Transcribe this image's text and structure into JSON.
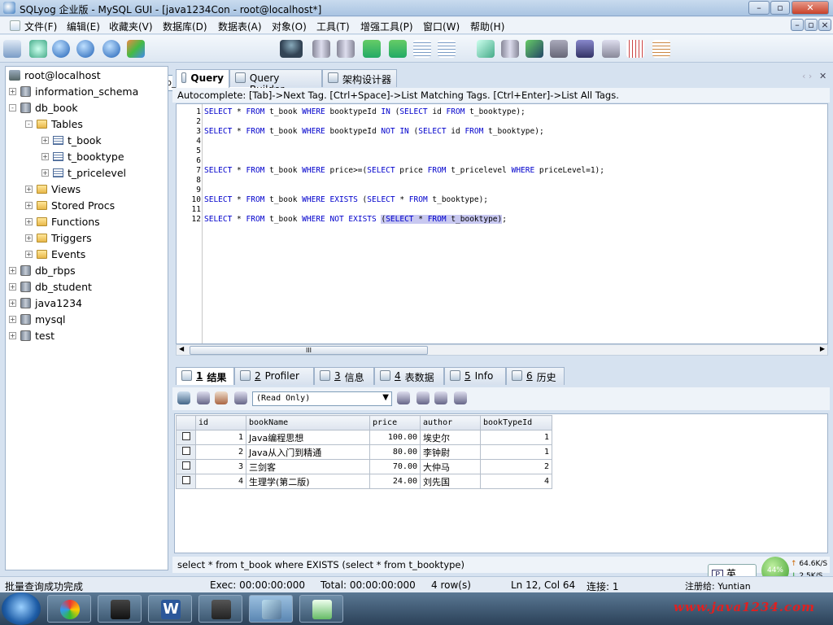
{
  "window": {
    "title": "SQLyog 企业版 - MySQL GUI - [java1234Con - root@localhost*]"
  },
  "menu": [
    "文件(F)",
    "编辑(E)",
    "收藏夹(V)",
    "数据库(D)",
    "数据表(A)",
    "对象(O)",
    "工具(T)",
    "增强工具(P)",
    "窗口(W)",
    "帮助(H)"
  ],
  "toolbar": {
    "database": "db_book"
  },
  "tree": {
    "root": "root@localhost",
    "items": [
      {
        "label": "information_schema",
        "type": "db",
        "level": 1,
        "expand": "+"
      },
      {
        "label": "db_book",
        "type": "db",
        "level": 1,
        "expand": "-"
      },
      {
        "label": "Tables",
        "type": "folder",
        "level": 2,
        "expand": "-"
      },
      {
        "label": "t_book",
        "type": "table",
        "level": 3,
        "expand": "+",
        "selected": true
      },
      {
        "label": "t_booktype",
        "type": "table",
        "level": 3,
        "expand": "+"
      },
      {
        "label": "t_pricelevel",
        "type": "table",
        "level": 3,
        "expand": "+"
      },
      {
        "label": "Views",
        "type": "folder",
        "level": 2,
        "expand": "+"
      },
      {
        "label": "Stored Procs",
        "type": "folder",
        "level": 2,
        "expand": "+"
      },
      {
        "label": "Functions",
        "type": "folder",
        "level": 2,
        "expand": "+"
      },
      {
        "label": "Triggers",
        "type": "folder",
        "level": 2,
        "expand": "+"
      },
      {
        "label": "Events",
        "type": "folder",
        "level": 2,
        "expand": "+"
      },
      {
        "label": "db_rbps",
        "type": "db",
        "level": 1,
        "expand": "+"
      },
      {
        "label": "db_student",
        "type": "db",
        "level": 1,
        "expand": "+"
      },
      {
        "label": "java1234",
        "type": "db",
        "level": 1,
        "expand": "+"
      },
      {
        "label": "mysql",
        "type": "db",
        "level": 1,
        "expand": "+"
      },
      {
        "label": "test",
        "type": "db",
        "level": 1,
        "expand": "+"
      }
    ]
  },
  "query_tabs": [
    "Query",
    "Query Builder",
    "架构设计器"
  ],
  "autocomplete_hint": "Autocomplete: [Tab]->Next Tag. [Ctrl+Space]->List Matching Tags. [Ctrl+Enter]->List All Tags.",
  "editor": {
    "lines": [
      "SELECT * FROM t_book WHERE booktypeId IN (SELECT id FROM t_booktype);",
      "",
      "SELECT * FROM t_book WHERE booktypeId NOT IN (SELECT id FROM t_booktype);",
      "",
      "",
      "",
      "SELECT * FROM t_book WHERE price>=(SELECT price FROM t_pricelevel WHERE priceLevel=1);",
      "",
      "",
      "SELECT * FROM t_book WHERE EXISTS (SELECT * FROM t_booktype);",
      "",
      "SELECT * FROM t_book WHERE NOT EXISTS (SELECT * FROM t_booktype);"
    ],
    "scroll_label": "III"
  },
  "result_tabs": [
    {
      "num": "1",
      "label": "结果"
    },
    {
      "num": "2",
      "label": "Profiler"
    },
    {
      "num": "3",
      "label": "信息"
    },
    {
      "num": "4",
      "label": "表数据"
    },
    {
      "num": "5",
      "label": "Info"
    },
    {
      "num": "6",
      "label": "历史"
    }
  ],
  "result_mode": "(Read Only)",
  "grid": {
    "columns": [
      "id",
      "bookName",
      "price",
      "author",
      "bookTypeId"
    ],
    "rows": [
      [
        "1",
        "Java编程思想",
        "100.00",
        "埃史尔",
        "1"
      ],
      [
        "2",
        "Java从入门到精通",
        "80.00",
        "李钟尉",
        "1"
      ],
      [
        "3",
        "三剑客",
        "70.00",
        "大仲马",
        "2"
      ],
      [
        "4",
        "生理学(第二版)",
        "24.00",
        "刘先国",
        "4"
      ]
    ]
  },
  "last_sql": "select * from t_book where EXISTS (select * from t_booktype)",
  "ime": {
    "label": "英"
  },
  "speed": {
    "percent": "44%",
    "up": "64.6K/S",
    "down": "2.5K/S"
  },
  "status": {
    "message": "批量查询成功完成",
    "exec": "Exec: 00:00:00:000",
    "total": "Total: 00:00:00:000",
    "rows": "4 row(s)",
    "position": "Ln 12, Col 64",
    "connections": "连接: 1",
    "registered": "注册给: Yuntian"
  },
  "watermark": "www.java1234.com"
}
